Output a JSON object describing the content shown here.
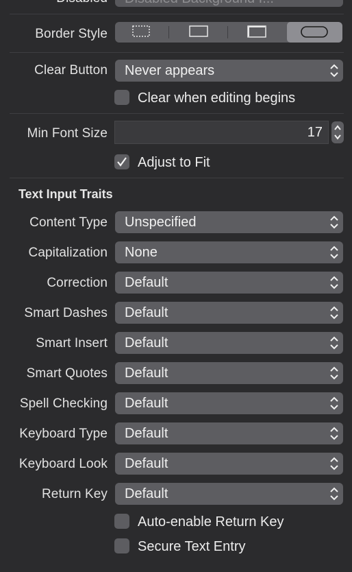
{
  "top_row": {
    "label": "Disabled",
    "value": "Disabled Background I..."
  },
  "border_style": {
    "label": "Border Style",
    "options": [
      "none-icon",
      "line-icon",
      "bezel-icon",
      "rounded-rect-icon"
    ],
    "selected": "rounded-rect-icon"
  },
  "clear_button": {
    "label": "Clear Button",
    "value": "Never appears",
    "checkbox_label": "Clear when editing begins",
    "checked": false
  },
  "min_font_size": {
    "label": "Min Font Size",
    "value": "17",
    "adjust_label": "Adjust to Fit",
    "adjust_checked": true
  },
  "text_input_traits": {
    "title": "Text Input Traits",
    "rows": [
      {
        "label": "Content Type",
        "value": "Unspecified"
      },
      {
        "label": "Capitalization",
        "value": "None"
      },
      {
        "label": "Correction",
        "value": "Default"
      },
      {
        "label": "Smart Dashes",
        "value": "Default"
      },
      {
        "label": "Smart Insert",
        "value": "Default"
      },
      {
        "label": "Smart Quotes",
        "value": "Default"
      },
      {
        "label": "Spell Checking",
        "value": "Default"
      },
      {
        "label": "Keyboard Type",
        "value": "Default"
      },
      {
        "label": "Keyboard Look",
        "value": "Default"
      },
      {
        "label": "Return Key",
        "value": "Default"
      }
    ],
    "checkboxes": [
      {
        "label": "Auto-enable Return Key",
        "checked": false
      },
      {
        "label": "Secure Text Entry",
        "checked": false
      }
    ]
  },
  "colors": {
    "panel_bg": "#2b2b2d",
    "control_bg": "#5d5d61",
    "selected_segment": "#8e8e93"
  }
}
